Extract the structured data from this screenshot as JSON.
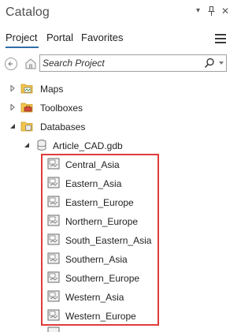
{
  "window": {
    "title": "Catalog",
    "controls": [
      "dropdown-icon",
      "pin-icon",
      "close-icon"
    ]
  },
  "tabs": [
    {
      "label": "Project",
      "selected": true
    },
    {
      "label": "Portal",
      "selected": false
    },
    {
      "label": "Favorites",
      "selected": false
    }
  ],
  "search": {
    "placeholder": "Search Project"
  },
  "tree": {
    "top_items": [
      {
        "label": "Maps",
        "icon": "maps-folder-icon",
        "expanded": false
      },
      {
        "label": "Toolboxes",
        "icon": "toolboxes-folder-icon",
        "expanded": false
      },
      {
        "label": "Databases",
        "icon": "databases-folder-icon",
        "expanded": true
      }
    ],
    "geodatabase": {
      "label": "Article_CAD.gdb",
      "icon": "geodatabase-icon",
      "expanded": true
    },
    "feature_datasets": [
      {
        "label": "Central_Asia"
      },
      {
        "label": "Eastern_Asia"
      },
      {
        "label": "Eastern_Europe"
      },
      {
        "label": "Northern_Europe"
      },
      {
        "label": "South_Eastern_Asia"
      },
      {
        "label": "Southern_Asia"
      },
      {
        "label": "Southern_Europe"
      },
      {
        "label": "Western_Asia"
      },
      {
        "label": "Western_Europe"
      }
    ]
  },
  "colors": {
    "accent": "#2f6ea8",
    "highlight_border": "#e03b3b",
    "folder_yellow": "#f2c54e"
  }
}
